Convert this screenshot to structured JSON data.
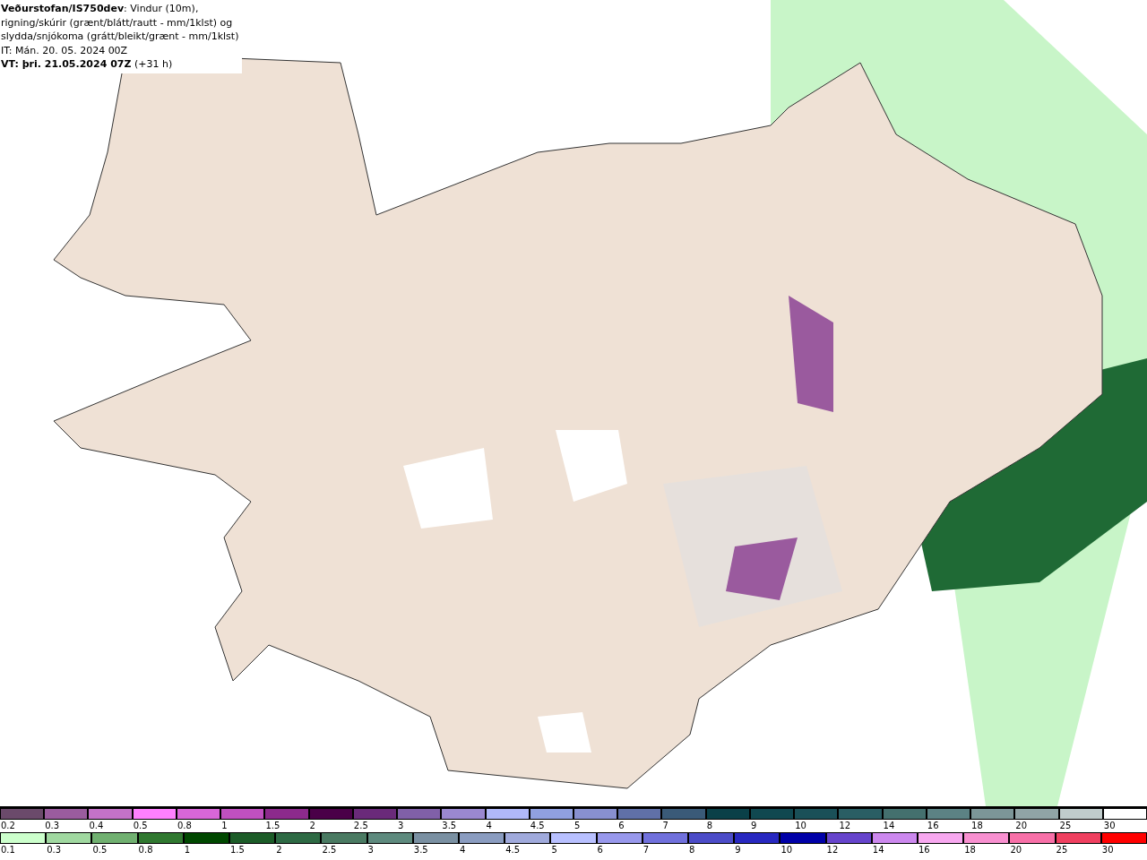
{
  "header": {
    "lines": [
      "**Veðurstofan/IS750dev**: Vindur (10m),",
      "rigning/skúrir (grænt/blátt/rautt - mm/1klst) og",
      "slydda/snjókoma (grátt/bleikt/grænt - mm/1klst)",
      "IT: Mán. 20. 05. 2024 00Z",
      "**VT: þri. 21.05.2024 07Z** (+31 h)"
    ]
  },
  "legends": [
    {
      "items": [
        {
          "label": "0.2",
          "color": "#6b4a6b"
        },
        {
          "label": "0.3",
          "color": "#9a5c9e"
        },
        {
          "label": "0.4",
          "color": "#c472c8"
        },
        {
          "label": "0.5",
          "color": "#ff80ff"
        },
        {
          "label": "0.8",
          "color": "#d866d8"
        },
        {
          "label": "1",
          "color": "#c050c0"
        },
        {
          "label": "1.5",
          "color": "#8c2a8c"
        },
        {
          "label": "2",
          "color": "#4a0048"
        },
        {
          "label": "2.5",
          "color": "#6a2a7a"
        },
        {
          "label": "3",
          "color": "#8060a8"
        },
        {
          "label": "3.5",
          "color": "#9a88d0"
        },
        {
          "label": "4",
          "color": "#b0b8f8"
        },
        {
          "label": "4.5",
          "color": "#90a0e0"
        },
        {
          "label": "5",
          "color": "#8890d0"
        },
        {
          "label": "6",
          "color": "#6070a8"
        },
        {
          "label": "7",
          "color": "#3a5a78"
        },
        {
          "label": "8",
          "color": "#0a4048"
        },
        {
          "label": "9",
          "color": "#104850"
        },
        {
          "label": "10",
          "color": "#1a5058"
        },
        {
          "label": "12",
          "color": "#2a5e64"
        },
        {
          "label": "14",
          "color": "#44706e"
        },
        {
          "label": "16",
          "color": "#5c8284"
        },
        {
          "label": "18",
          "color": "#7c9698"
        },
        {
          "label": "20",
          "color": "#90a4a6"
        },
        {
          "label": "25",
          "color": "#c0cccc"
        },
        {
          "label": "30",
          "color": "#ffffff"
        }
      ]
    },
    {
      "items": [
        {
          "label": "0.1",
          "color": "#ccffcc"
        },
        {
          "label": "0.3",
          "color": "#a0d8a0"
        },
        {
          "label": "0.5",
          "color": "#70b070"
        },
        {
          "label": "0.8",
          "color": "#307830"
        },
        {
          "label": "1",
          "color": "#004800"
        },
        {
          "label": "1.5",
          "color": "#1c5c28"
        },
        {
          "label": "2",
          "color": "#2e6a44"
        },
        {
          "label": "2.5",
          "color": "#4a7a62"
        },
        {
          "label": "3",
          "color": "#5e8a7e"
        },
        {
          "label": "3.5",
          "color": "#7a90a2"
        },
        {
          "label": "4",
          "color": "#8a9cc0"
        },
        {
          "label": "4.5",
          "color": "#a0aadc"
        },
        {
          "label": "5",
          "color": "#b8c0ff"
        },
        {
          "label": "6",
          "color": "#9898ec"
        },
        {
          "label": "7",
          "color": "#7070dc"
        },
        {
          "label": "8",
          "color": "#4c4cc8"
        },
        {
          "label": "9",
          "color": "#2828c0"
        },
        {
          "label": "10",
          "color": "#0000a8"
        },
        {
          "label": "12",
          "color": "#6644cc"
        },
        {
          "label": "14",
          "color": "#cc88ee"
        },
        {
          "label": "16",
          "color": "#f8a8f0"
        },
        {
          "label": "18",
          "color": "#f890d0"
        },
        {
          "label": "20",
          "color": "#f870a8"
        },
        {
          "label": "25",
          "color": "#f04060"
        },
        {
          "label": "30",
          "color": "#ff0000"
        }
      ]
    }
  ]
}
